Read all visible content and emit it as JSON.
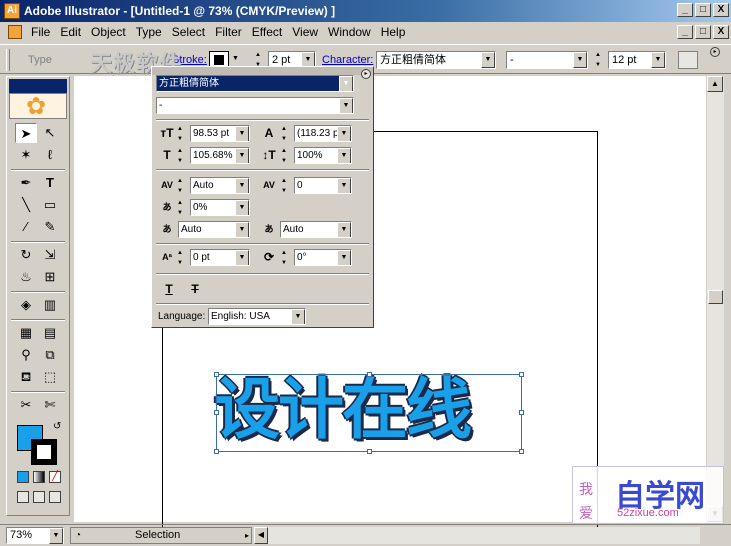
{
  "window": {
    "title": "Adobe Illustrator - [Untitled-1 @ 73% (CMYK/Preview) ]",
    "controls": [
      "_",
      "□",
      "X"
    ]
  },
  "menu": [
    "File",
    "Edit",
    "Object",
    "Type",
    "Select",
    "Filter",
    "Effect",
    "View",
    "Window",
    "Help"
  ],
  "control_bar": {
    "type_label": "Type",
    "stroke_label": "Stroke:",
    "stroke_weight": "2 pt",
    "character_label": "Character:",
    "font_family": "方正粗倩简体",
    "font_style": "-",
    "font_size": "12 pt"
  },
  "watermark_top": {
    "line1": "天极软件",
    "line2": "Soft.yesky.com"
  },
  "character_panel": {
    "font_family": "方正粗倩简体",
    "font_style": "-",
    "font_size": "98.53 pt",
    "leading": "(118.23 p",
    "horizontal_scale": "105.68%",
    "vertical_scale": "100%",
    "kerning": "Auto",
    "tracking": "0",
    "baseline_shift_pct": "0%",
    "auto_a": "Auto",
    "auto_b": "Auto",
    "baseline_shift": "0 pt",
    "rotation": "0°",
    "language_label": "Language:",
    "language": "English: USA"
  },
  "artwork": {
    "text": "设计在线",
    "fill": "#1aa0e8",
    "stroke": "#1a2a4a"
  },
  "toolbox": {
    "fill_color": "#1aa0e8",
    "stroke_color": "#000000"
  },
  "status": {
    "zoom": "73%",
    "tool": "Selection"
  },
  "watermark_bottom": {
    "main": "自学网",
    "side": "我爱",
    "url": "52zixue.com"
  }
}
